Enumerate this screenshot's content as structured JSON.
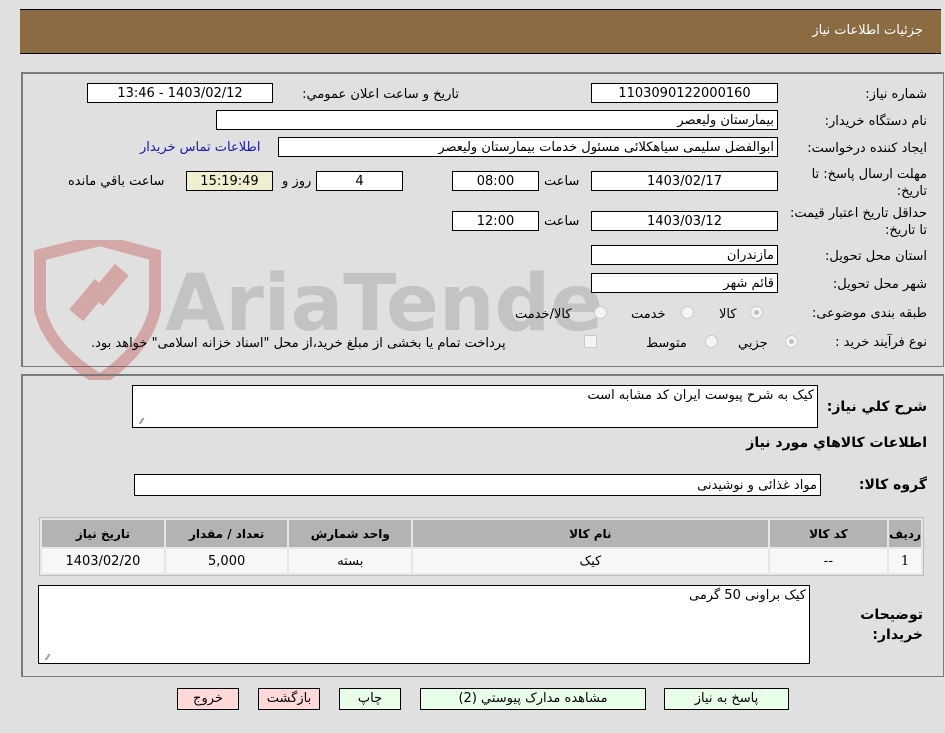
{
  "header": {
    "title": "جزئيات اطلاعات نياز"
  },
  "fields": {
    "need_number_label": "شماره نیاز:",
    "need_number": "1103090122000160",
    "announce_label": "تاريخ و ساعت اعلان عمومي:",
    "announce_value": "1403/02/12 - 13:46",
    "buyer_org_label": "نام دستگاه خریدار:",
    "buyer_org": "بیمارستان ولیعصر",
    "requester_label": "ایجاد کننده درخواست:",
    "requester": "ابوالفضل سلیمی سیاهکلائی مسئول خدمات بیمارستان ولیعصر",
    "buyer_contact_link": "اطلاعات تماس خریدار",
    "deadline_label": "مهلت ارسال پاسخ: تا تاریخ:",
    "deadline_date": "1403/02/17",
    "time_label": "ساعت",
    "deadline_time": "08:00",
    "days_remaining": "4",
    "days_label": "روز و",
    "time_remaining": "15:19:49",
    "remaining_label": "ساعت باقي مانده",
    "validity_label": "حداقل تاریخ اعتبار قیمت: تا تاریخ:",
    "validity_date": "1403/03/12",
    "validity_time": "12:00",
    "province_label": "استان محل تحویل:",
    "province": "مازندران",
    "city_label": "شهر محل تحویل:",
    "city": "قائم شهر",
    "category_label": "طبقه بندی موضوعی:",
    "category_options": [
      {
        "label": "کالا",
        "checked": true
      },
      {
        "label": "خدمت",
        "checked": false
      },
      {
        "label": "کالا/خدمت",
        "checked": false
      }
    ],
    "process_label": "نوع فرآیند خرید :",
    "process_options": [
      {
        "label": "جزيي",
        "checked": true
      },
      {
        "label": "متوسط",
        "checked": false
      }
    ],
    "treasury_note": "پرداخت تمام یا بخشی از مبلغ خرید،از محل \"اسناد خزانه اسلامی\" خواهد بود."
  },
  "details": {
    "summary_label": "شرح کلي نياز:",
    "summary": "کیک به شرح پیوست ایران کد مشابه است",
    "goods_info_title": "اطلاعات کالاهاي مورد نياز",
    "goods_group_label": "گروه کالا:",
    "goods_group": "مواد غذائی و نوشیدنی",
    "table": {
      "headers": [
        "ردیف",
        "کد کالا",
        "نام کالا",
        "واحد شمارش",
        "تعداد / مقدار",
        "تاریخ نیاز"
      ],
      "rows": [
        [
          "1",
          "--",
          "کیک",
          "بسته",
          "5,000",
          "1403/02/20"
        ]
      ]
    },
    "buyer_notes_label": "توضیحات خریدار:",
    "buyer_notes": "کیک براونی 50 گرمی"
  },
  "buttons": {
    "reply": "پاسخ به نياز",
    "attachments": "مشاهده مدارک پيوستي (2)",
    "print": "چاپ",
    "back": "بازگشت",
    "exit": "خروج"
  },
  "watermark": {
    "text": "AriaTender.neT"
  }
}
